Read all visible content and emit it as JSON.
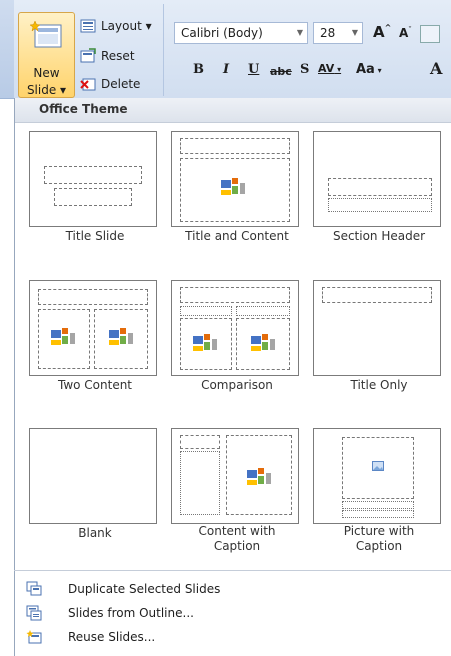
{
  "ribbon": {
    "new_slide_line1": "New",
    "new_slide_line2": "Slide ▾",
    "layout_label": "Layout ▾",
    "reset_label": "Reset",
    "delete_label": "Delete",
    "font_name": "Calibri (Body)",
    "font_size": "28",
    "grow_font": "A",
    "shrink_font": "A",
    "bold": "B",
    "italic": "I",
    "underline": "U",
    "strikethrough": "abc",
    "shadow": "S",
    "spacing": "AV",
    "change_case": "Aa",
    "font_color": "A"
  },
  "gallery": {
    "header": "Office Theme",
    "layouts": [
      {
        "name": "Title Slide"
      },
      {
        "name": "Title and Content"
      },
      {
        "name": "Section Header"
      },
      {
        "name": "Two Content"
      },
      {
        "name": "Comparison"
      },
      {
        "name": "Title Only"
      },
      {
        "name": "Blank"
      },
      {
        "name_line1": "Content with",
        "name_line2": "Caption"
      },
      {
        "name_line1": "Picture with",
        "name_line2": "Caption"
      }
    ]
  },
  "menu": {
    "items": [
      {
        "label": "Duplicate Selected Slides"
      },
      {
        "label": "Slides from Outline..."
      },
      {
        "label": "Reuse Slides..."
      }
    ]
  },
  "colors": {
    "accent": "#ffd36b",
    "ribbon_bg": "#d1def0",
    "panel_border": "#97a7bd"
  }
}
